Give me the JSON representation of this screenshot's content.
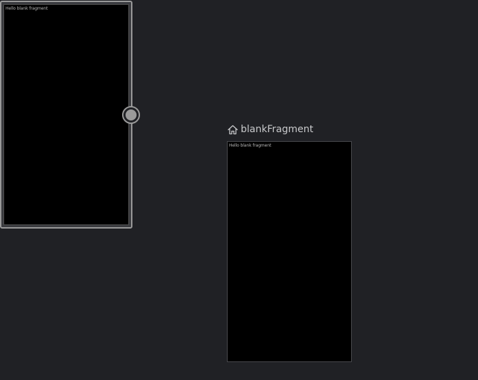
{
  "destinations": [
    {
      "id": "selected_destination",
      "preview_text": "Hello blank fragment",
      "selected": true
    },
    {
      "id": "start_destination",
      "label": "blankFragment",
      "preview_text": "Hello blank fragment",
      "is_start_destination": true
    }
  ],
  "icons": {
    "start_destination_icon": "home-icon"
  },
  "colors": {
    "canvas_background": "#202125",
    "selection_border": "#9a9a9a",
    "screen_background": "#000000",
    "label_text": "#c9cacc"
  }
}
